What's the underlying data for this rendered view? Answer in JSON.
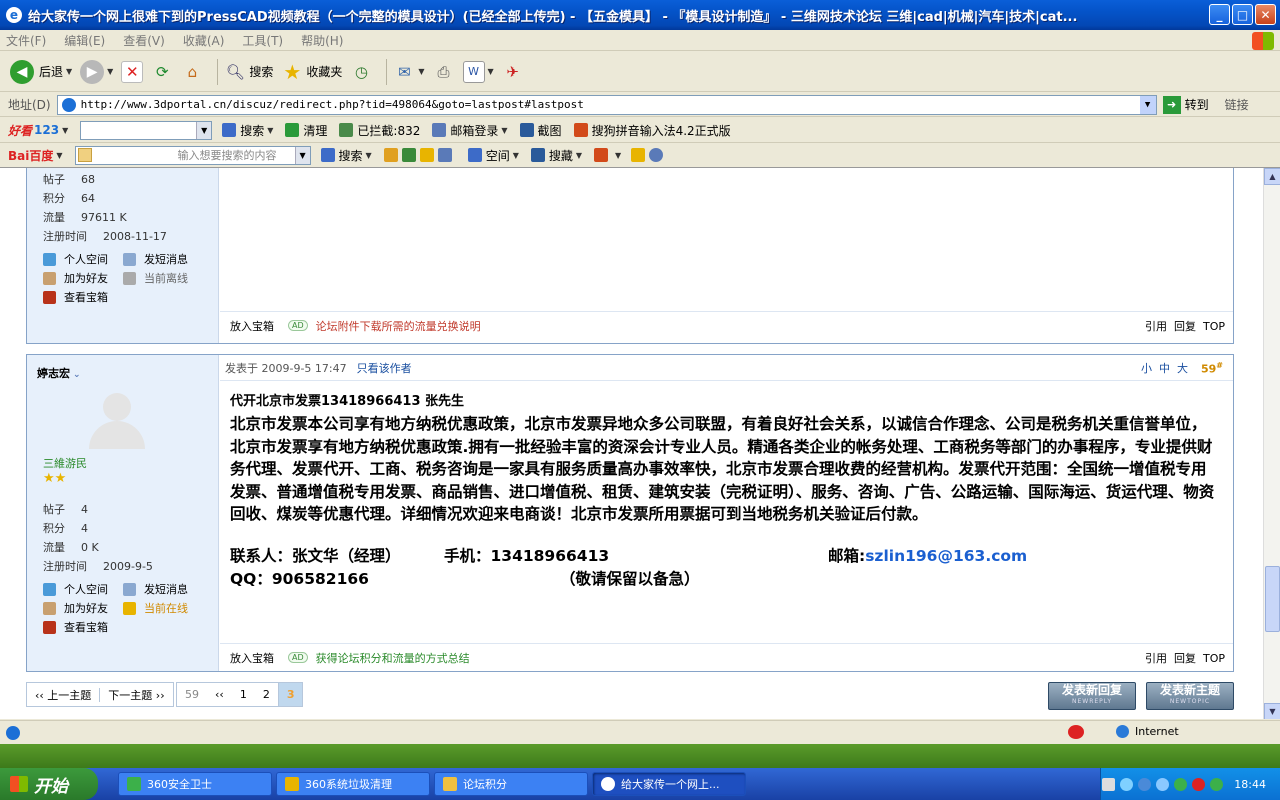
{
  "window": {
    "title": "给大家传一个网上很难下到的PressCAD视频教程（一个完整的模具设计）(已经全部上传完) - 【五金模具】 - 『模具设计制造』 - 三维网技术论坛 三维|cad|机械|汽车|技术|cat..."
  },
  "menu": [
    "文件(F)",
    "编辑(E)",
    "查看(V)",
    "收藏(A)",
    "工具(T)",
    "帮助(H)"
  ],
  "toolbar": {
    "back": "后退",
    "search": "搜索",
    "favorites": "收藏夹"
  },
  "address": {
    "label": "地址(D)",
    "url": "http://www.3dportal.cn/discuz/redirect.php?tid=498064&goto=lastpost#lastpost",
    "go": "转到",
    "links": "链接"
  },
  "hao123": {
    "brand": "123",
    "search": "搜索",
    "clean": "清理",
    "blocked": "已拦截:832",
    "mail": "邮箱登录",
    "screenshot": "截图",
    "sogou": "搜狗拼音输入法4.2正式版"
  },
  "baidu": {
    "brand": "Bai百度",
    "placeholder": "输入想要搜索的内容",
    "search": "搜索",
    "space": "空间",
    "collect": "搜藏"
  },
  "post1": {
    "stats": [
      {
        "k": "帖子",
        "v": "68"
      },
      {
        "k": "积分",
        "v": "64"
      },
      {
        "k": "流量",
        "v": "97611 K"
      },
      {
        "k": "注册时间",
        "v": "2008-11-17"
      }
    ],
    "actions": {
      "space": "个人空间",
      "msg": "发短消息",
      "friend": "加为好友",
      "status": "当前离线",
      "treasure": "查看宝箱"
    },
    "footer": {
      "box": "放入宝箱",
      "ad": "AD",
      "link": "论坛附件下载所需的流量兑换说明",
      "quote": "引用",
      "reply": "回复",
      "top": "TOP"
    }
  },
  "post2": {
    "author": "婷志宏",
    "group": "三維游民",
    "stats": [
      {
        "k": "帖子",
        "v": "4"
      },
      {
        "k": "积分",
        "v": "4"
      },
      {
        "k": "流量",
        "v": "0 K"
      },
      {
        "k": "注册时间",
        "v": "2009-9-5"
      }
    ],
    "actions": {
      "space": "个人空间",
      "msg": "发短消息",
      "friend": "加为好友",
      "status": "当前在线",
      "treasure": "查看宝箱"
    },
    "posted": "发表于 2009-9-5 17:47",
    "only_author": "只看该作者",
    "size_small": "小",
    "size_mid": "中",
    "size_big": "大",
    "floor": "59",
    "floor_mark": "#",
    "subject": "代开北京市发票13418966413 张先生",
    "body": "北京市发票本公司享有地方纳税优惠政策，北京市发票异地众多公司联盟，有着良好社会关系，以诚信合作理念、公司是税务机关重信誉单位，北京市发票享有地方纳税优惠政策.拥有一批经验丰富的资深会计专业人员。精通各类企业的帐务处理、工商税务等部门的办事程序，专业提供财务代理、发票代开、工商、税务咨询是一家具有服务质量高办事效率快，北京市发票合理收费的经营机构。发票代开范围：全国统一增值税专用发票、普通增值税专用发票、商品销售、进口增值税、租赁、建筑安装（完税证明）、服务、咨询、广告、公路运输、国际海运、货运代理、物资回收、煤炭等优惠代理。详细情况欢迎来电商谈！北京市发票所用票据可到当地税务机关验证后付款。",
    "contact": "联系人：张文华（经理）",
    "phone": "手机：13418966413",
    "email_label": "邮箱:",
    "email": "szlin196@163.com",
    "qq": "QQ：906582166",
    "note": "（敬请保留以备急）",
    "footer": {
      "box": "放入宝箱",
      "ad": "AD",
      "link": "获得论坛积分和流量的方式总结",
      "quote": "引用",
      "reply": "回复",
      "top": "TOP"
    }
  },
  "nav": {
    "prev": "‹‹ 上一主题",
    "next": "下一主题 ››"
  },
  "pager": {
    "total": "59",
    "first": "‹‹",
    "p1": "1",
    "p2": "2",
    "p3": "3"
  },
  "buttons": {
    "newreply": "发表新回复",
    "newreply_en": "NEWREPLY",
    "newtopic": "发表新主题",
    "newtopic_en": "NEWTOPIC"
  },
  "status": {
    "zone": "Internet"
  },
  "taskbar": {
    "start": "开始",
    "tasks": [
      "360安全卫士",
      "360系统垃圾清理",
      "论坛积分",
      "给大家传一个网上..."
    ],
    "clock": "18:44"
  },
  "colors": {
    "title_bar": "#0453c8",
    "post_border": "#86a3c8",
    "sidebar_bg": "#e7f0fb",
    "link_red": "#c0392b",
    "group_green": "#2a8a2a",
    "email_blue": "#1a5fd0"
  }
}
